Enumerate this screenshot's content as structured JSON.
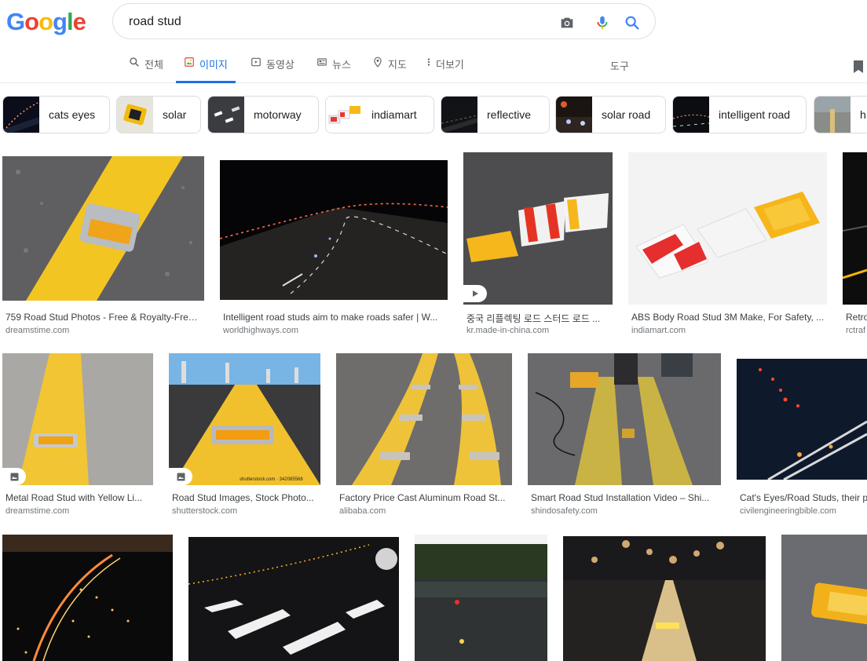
{
  "logo": {
    "letters": [
      "G",
      "o",
      "o",
      "g",
      "l",
      "e"
    ]
  },
  "search": {
    "query": "road stud"
  },
  "tabs": [
    {
      "label": "전체"
    },
    {
      "label": "이미지"
    },
    {
      "label": "동영상"
    },
    {
      "label": "뉴스"
    },
    {
      "label": "지도"
    },
    {
      "label": "더보기"
    }
  ],
  "tools_label": "도구",
  "chips": [
    {
      "label": "cats eyes"
    },
    {
      "label": "solar"
    },
    {
      "label": "motorway"
    },
    {
      "label": "indiamart"
    },
    {
      "label": "reflective"
    },
    {
      "label": "solar road"
    },
    {
      "label": "intelligent road"
    },
    {
      "label": "h"
    }
  ],
  "results": [
    {
      "title": "759 Road Stud Photos - Free & Royalty-Free ...",
      "source": "dreamstime.com"
    },
    {
      "title": "Intelligent road studs aim to make roads safer | W...",
      "source": "worldhighways.com"
    },
    {
      "title": "중국 리플렉팅 로드 스터드 로드 ...",
      "source": "kr.made-in-china.com"
    },
    {
      "title": "ABS Body Road Stud 3M Make, For Safety, ...",
      "source": "indiamart.com"
    },
    {
      "title": "Retro",
      "source": "rctraf"
    },
    {
      "title": "Metal Road Stud with Yellow Li...",
      "source": "dreamstime.com"
    },
    {
      "title": "Road Stud Images, Stock Photo...",
      "source": "shutterstock.com"
    },
    {
      "title": "Factory Price Cast Aluminum Road St...",
      "source": "alibaba.com"
    },
    {
      "title": "Smart Road Stud Installation Video – Shi...",
      "source": "shindosafety.com"
    },
    {
      "title": "Cat's Eyes/Road Studs, their p",
      "source": "civilengineeringbible.com"
    }
  ],
  "watermark": "shutterstock.com · 342085568",
  "colors": {
    "accent": "#1a73e8",
    "muted": "#5f6368",
    "border": "#dfe1e5"
  }
}
